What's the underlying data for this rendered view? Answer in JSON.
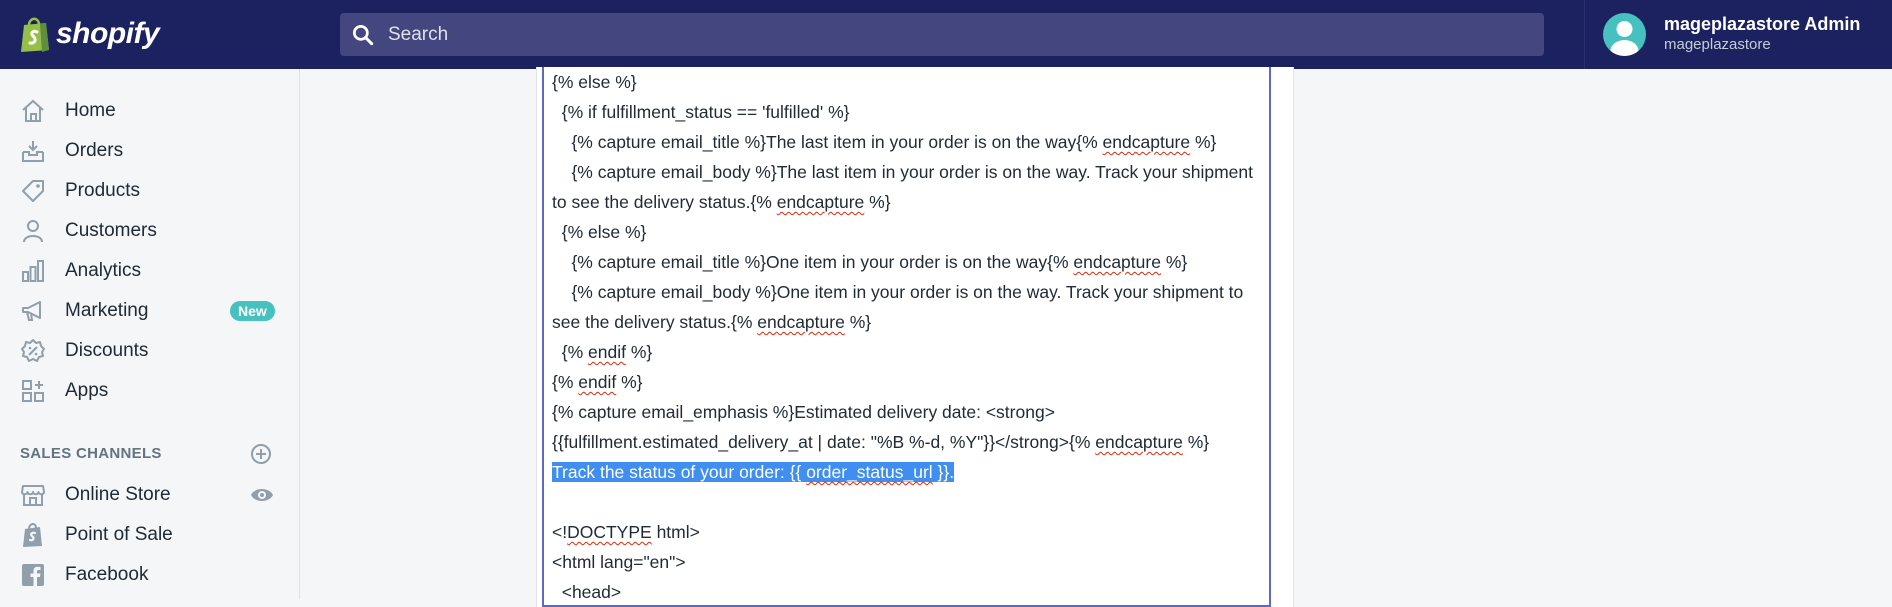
{
  "topbar": {
    "brand": "shopify",
    "search_placeholder": "Search",
    "account_name": "mageplazastore Admin",
    "account_store": "mageplazastore"
  },
  "sidebar": {
    "items": [
      {
        "label": "Home",
        "icon": "home-icon"
      },
      {
        "label": "Orders",
        "icon": "orders-icon"
      },
      {
        "label": "Products",
        "icon": "tag-icon"
      },
      {
        "label": "Customers",
        "icon": "person-icon"
      },
      {
        "label": "Analytics",
        "icon": "bar-chart-icon"
      },
      {
        "label": "Marketing",
        "icon": "megaphone-icon",
        "badge": "New"
      },
      {
        "label": "Discounts",
        "icon": "discount-icon"
      },
      {
        "label": "Apps",
        "icon": "apps-icon"
      }
    ],
    "sales_channels_header": "SALES CHANNELS",
    "channels": [
      {
        "label": "Online Store",
        "icon": "store-icon"
      },
      {
        "label": "Point of Sale",
        "icon": "pos-bag-icon"
      },
      {
        "label": "Facebook",
        "icon": "facebook-icon"
      }
    ]
  },
  "editor": {
    "lines": [
      {
        "parts": [
          {
            "t": "{% else %}"
          }
        ]
      },
      {
        "parts": [
          {
            "t": "  {% if fulfillment_status == 'fulfilled' %}"
          }
        ]
      },
      {
        "parts": [
          {
            "t": "    {% capture email_title %}The last item in your order is on the way{% "
          },
          {
            "t": "endcapture",
            "spell": true
          },
          {
            "t": " %}"
          }
        ]
      },
      {
        "parts": [
          {
            "t": "    {% capture email_body %}The last item in your order is on the way. Track your shipment"
          }
        ]
      },
      {
        "parts": [
          {
            "t": "to see the delivery status.{% "
          },
          {
            "t": "endcapture",
            "spell": true
          },
          {
            "t": " %}"
          }
        ]
      },
      {
        "parts": [
          {
            "t": "  {% else %}"
          }
        ]
      },
      {
        "parts": [
          {
            "t": "    {% capture email_title %}One item in your order is on the way{% "
          },
          {
            "t": "endcapture",
            "spell": true
          },
          {
            "t": " %}"
          }
        ]
      },
      {
        "parts": [
          {
            "t": "    {% capture email_body %}One item in your order is on the way. Track your shipment to"
          }
        ]
      },
      {
        "parts": [
          {
            "t": "see the delivery status.{% "
          },
          {
            "t": "endcapture",
            "spell": true
          },
          {
            "t": " %}"
          }
        ]
      },
      {
        "parts": [
          {
            "t": "  {% "
          },
          {
            "t": "endif",
            "spell": true
          },
          {
            "t": " %}"
          }
        ]
      },
      {
        "parts": [
          {
            "t": "{% "
          },
          {
            "t": "endif",
            "spell": true
          },
          {
            "t": " %}"
          }
        ]
      },
      {
        "parts": [
          {
            "t": "{% capture email_emphasis %}Estimated delivery date: <strong>"
          }
        ]
      },
      {
        "parts": [
          {
            "t": "{{fulfillment.estimated_delivery_at | date: \"%B %-d, %Y\"}}</strong>{% "
          },
          {
            "t": "endcapture",
            "spell": true
          },
          {
            "t": " %}"
          }
        ]
      },
      {
        "selected": true,
        "parts": [
          {
            "t": "Track the status of your order: {{ "
          },
          {
            "t": "order_status_url",
            "spell": true
          },
          {
            "t": " }}."
          }
        ]
      },
      {
        "parts": [
          {
            "t": ""
          }
        ]
      },
      {
        "parts": [
          {
            "t": "<!"
          },
          {
            "t": "DOCTYPE",
            "spell": true
          },
          {
            "t": " html>"
          }
        ]
      },
      {
        "parts": [
          {
            "t": "<html lang=\"en\">"
          }
        ]
      },
      {
        "parts": [
          {
            "t": "  <head>"
          }
        ]
      }
    ]
  }
}
